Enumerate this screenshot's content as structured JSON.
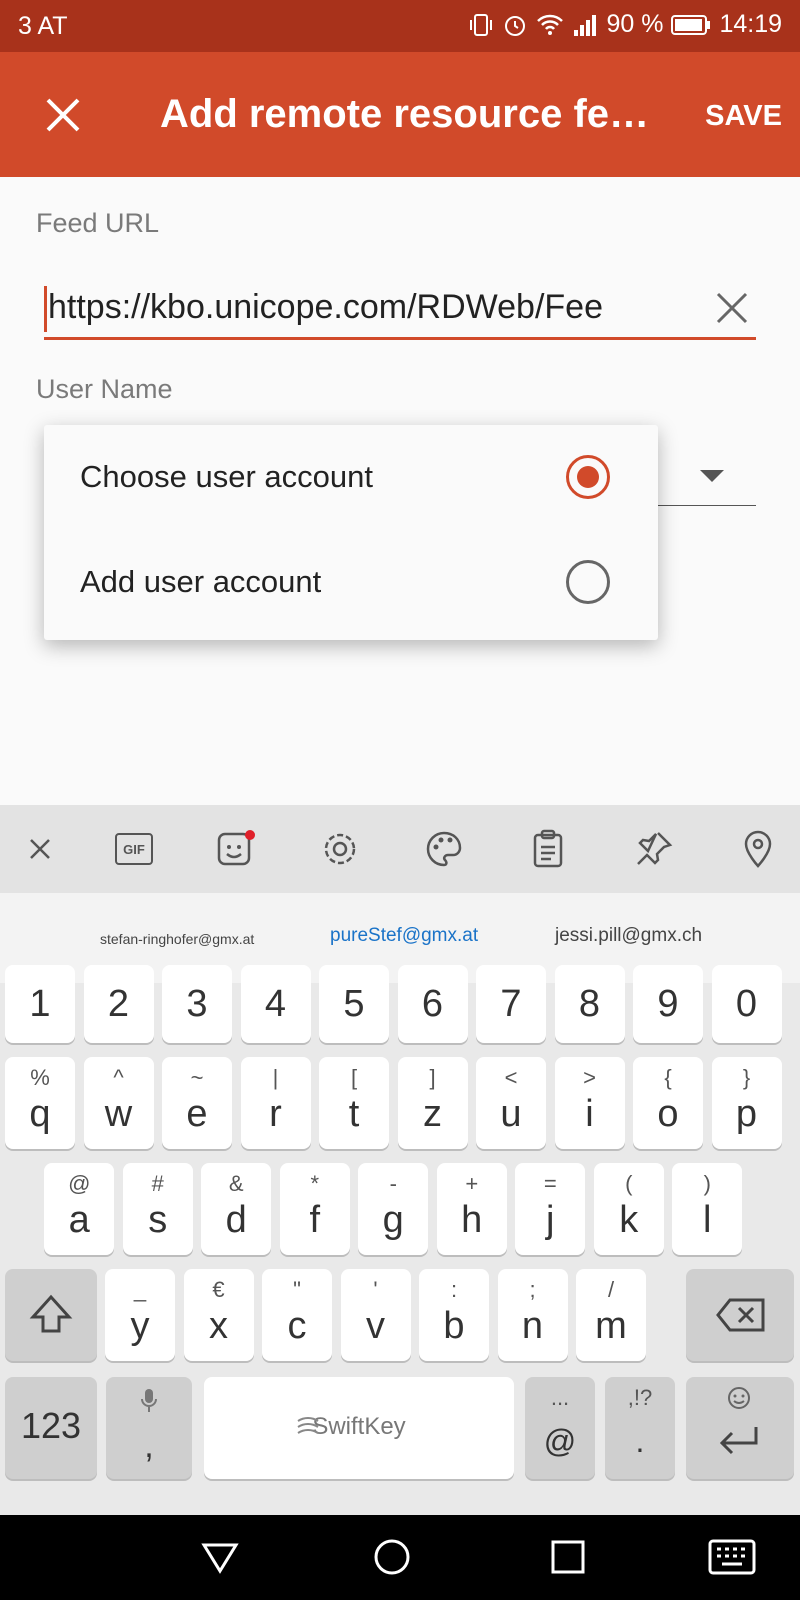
{
  "status_bar": {
    "carrier": "3 AT",
    "battery": "90 %",
    "time": "14:19"
  },
  "app_bar": {
    "title": "Add remote resource fe…",
    "save_label": "SAVE"
  },
  "form": {
    "feed_url_label": "Feed URL",
    "feed_url_value": "https://kbo.unicope.com/RDWeb/Fee",
    "user_name_label": "User Name"
  },
  "popup": {
    "options": [
      {
        "label": "Choose user account",
        "selected": true
      },
      {
        "label": "Add user account",
        "selected": false
      }
    ]
  },
  "keyboard": {
    "toolbar_icons": [
      "close-icon",
      "gif-icon",
      "sticker-icon",
      "gear-icon",
      "theme-palette-icon",
      "clipboard-icon",
      "pin-icon",
      "location-icon"
    ],
    "gif_label": "GIF",
    "suggestions": [
      "stefan-ringhofer@gmx.at",
      "pureStef@gmx.at",
      "jessi.pill@gmx.ch"
    ],
    "row_numbers": [
      "1",
      "2",
      "3",
      "4",
      "5",
      "6",
      "7",
      "8",
      "9",
      "0"
    ],
    "row1": [
      {
        "main": "q",
        "sub": "%"
      },
      {
        "main": "w",
        "sub": "^"
      },
      {
        "main": "e",
        "sub": "~"
      },
      {
        "main": "r",
        "sub": "|"
      },
      {
        "main": "t",
        "sub": "["
      },
      {
        "main": "z",
        "sub": "]"
      },
      {
        "main": "u",
        "sub": "<"
      },
      {
        "main": "i",
        "sub": ">"
      },
      {
        "main": "o",
        "sub": "{"
      },
      {
        "main": "p",
        "sub": "}"
      }
    ],
    "row2": [
      {
        "main": "a",
        "sub": "@"
      },
      {
        "main": "s",
        "sub": "#"
      },
      {
        "main": "d",
        "sub": "&"
      },
      {
        "main": "f",
        "sub": "*"
      },
      {
        "main": "g",
        "sub": "-"
      },
      {
        "main": "h",
        "sub": "+"
      },
      {
        "main": "j",
        "sub": "="
      },
      {
        "main": "k",
        "sub": "("
      },
      {
        "main": "l",
        "sub": ")"
      }
    ],
    "row3": [
      {
        "main": "y",
        "sub": "_"
      },
      {
        "main": "x",
        "sub": "€"
      },
      {
        "main": "c",
        "sub": "\""
      },
      {
        "main": "v",
        "sub": "'"
      },
      {
        "main": "b",
        "sub": ":"
      },
      {
        "main": "n",
        "sub": ";"
      },
      {
        "main": "m",
        "sub": "/"
      }
    ],
    "bottom": {
      "numbers": "123",
      "comma": ",",
      "space": "SwiftKey",
      "at_sub": "...",
      "at": "@",
      "period_sub": ",!?",
      "period": "."
    }
  },
  "colors": {
    "accent": "#d14a2a",
    "status": "#a8321b",
    "suggestion_highlight": "#1a73c8"
  }
}
